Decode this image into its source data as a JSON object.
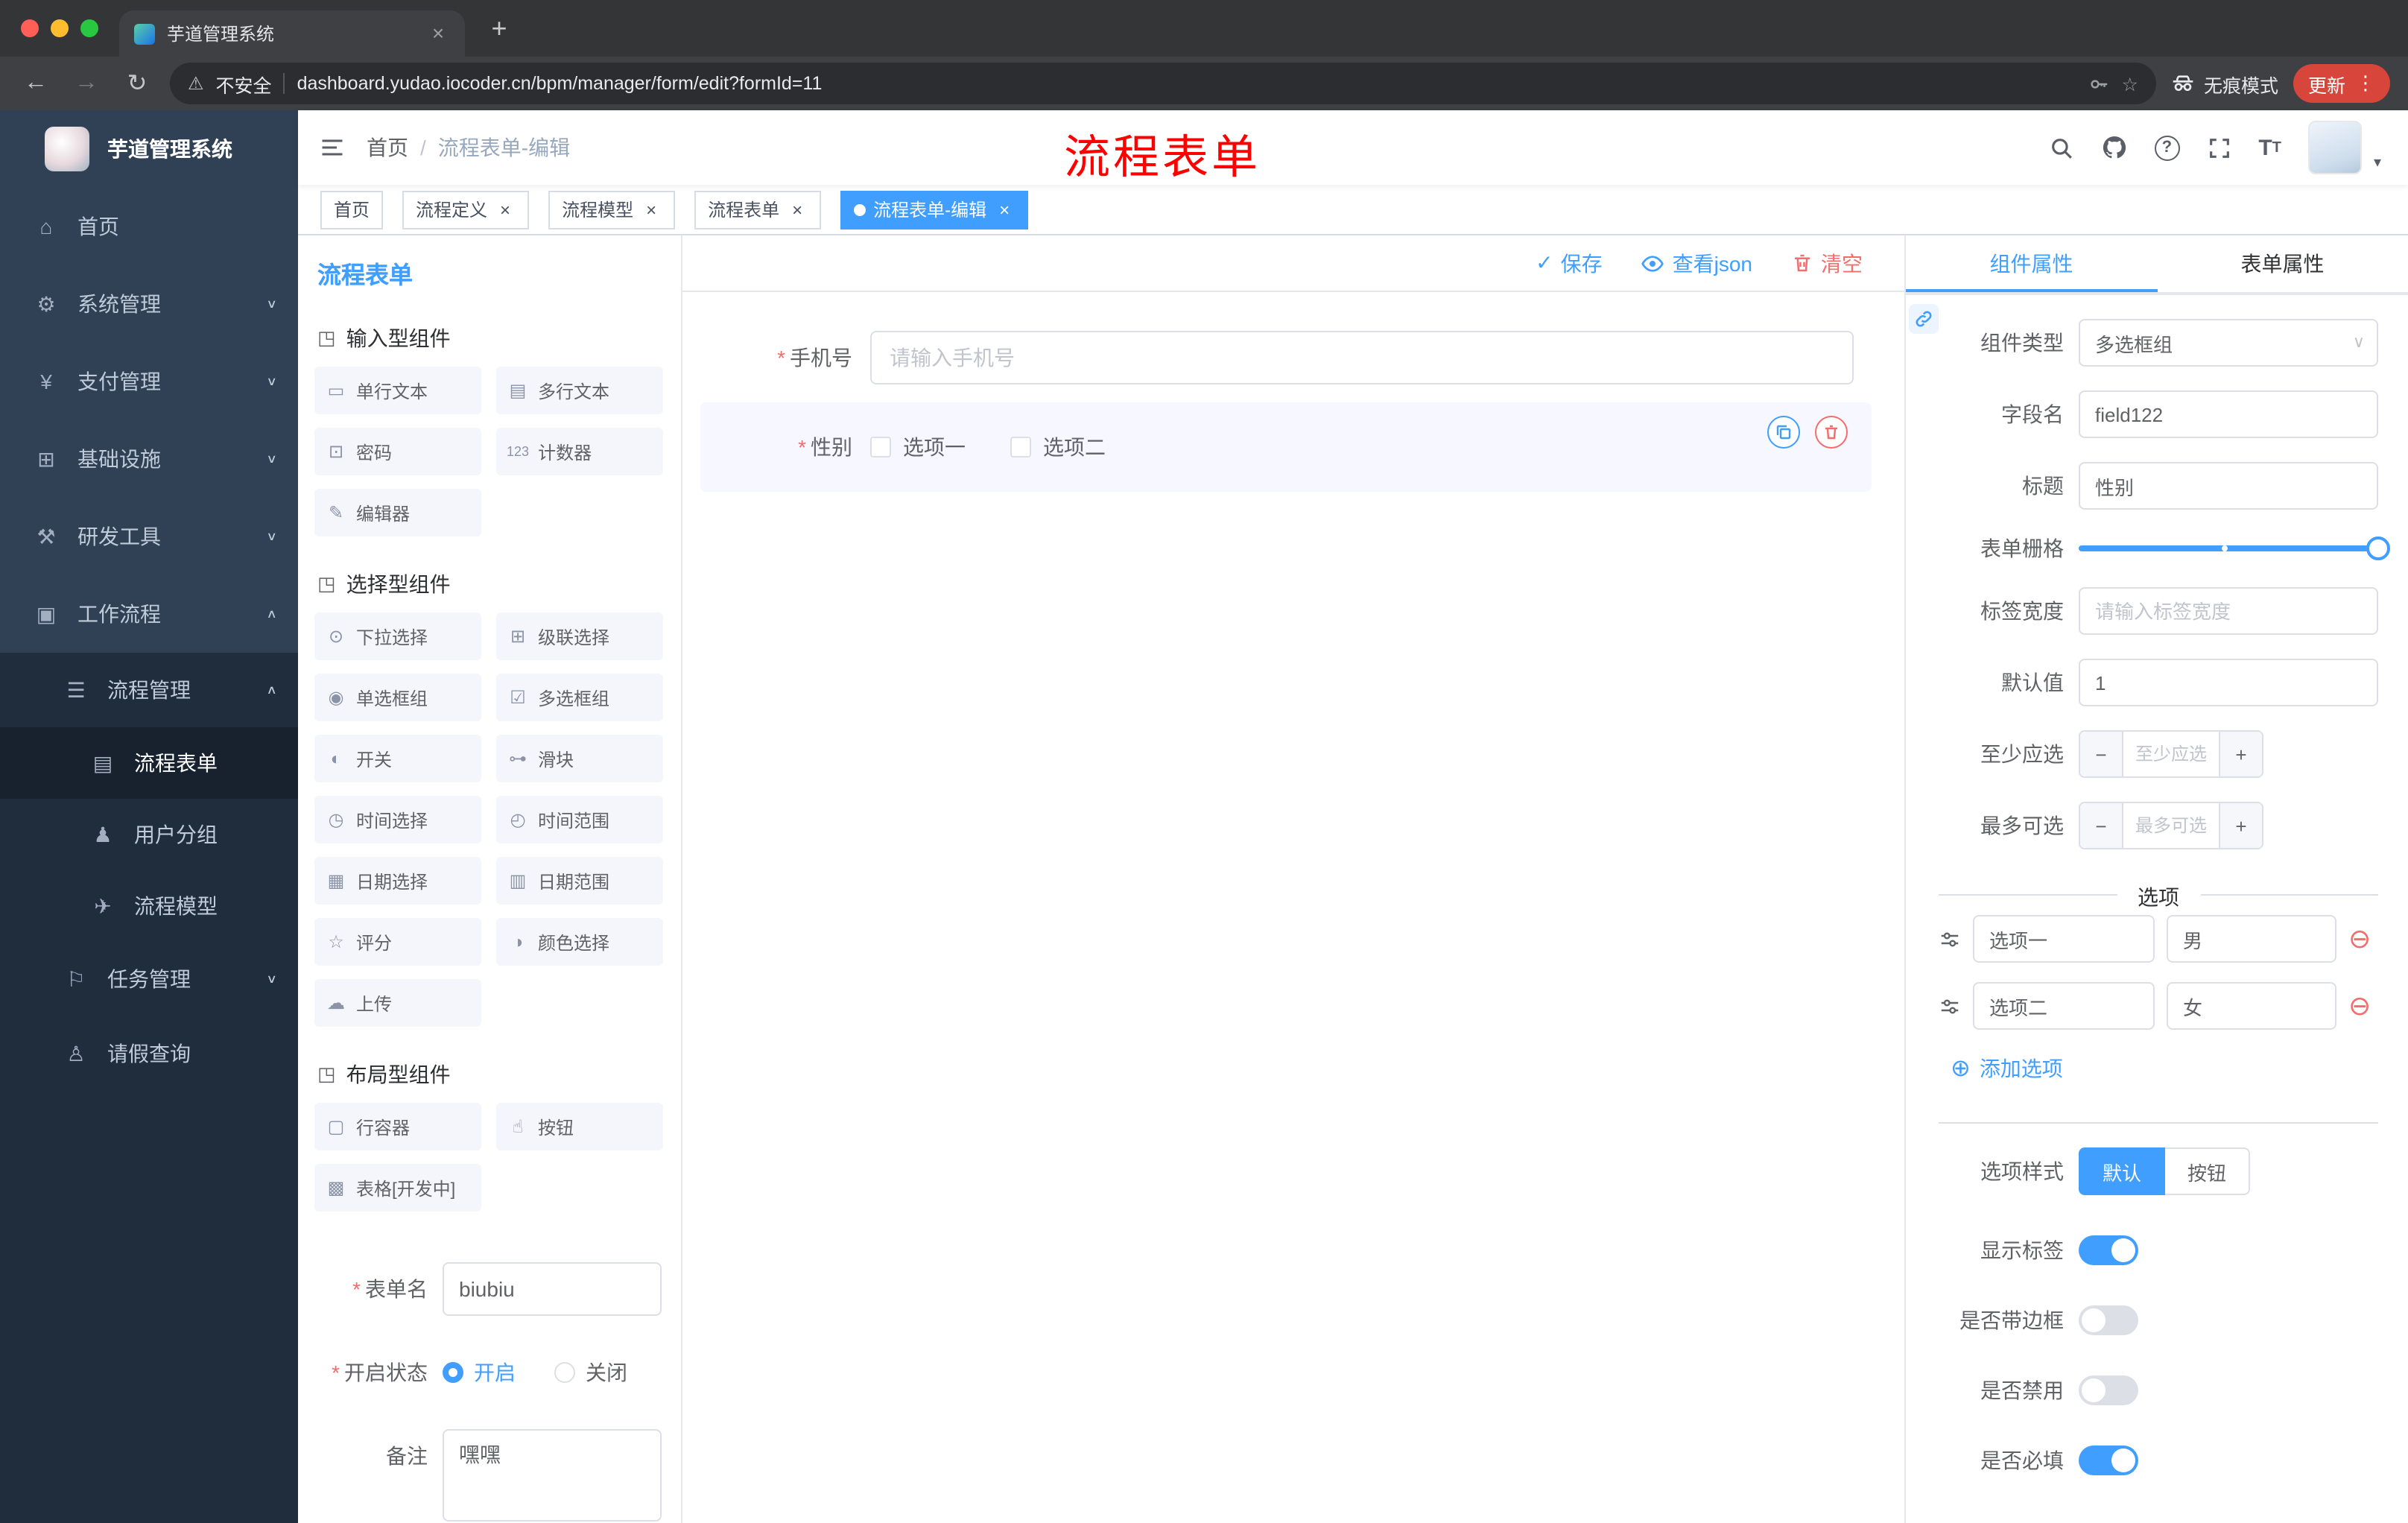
{
  "colors": {
    "accent": "#409eff",
    "danger": "#f56c6c",
    "sidebar_bg": "#304156",
    "sidebar_submenu_bg": "#1f2d3d",
    "update_button": "#d8453a",
    "annotation": "#ff0000",
    "selected_widget_bg": "#f6f7ff"
  },
  "icons": {
    "close": "×",
    "new_tab": "+",
    "back": "←",
    "forward": "→",
    "reload": "↻",
    "warning": "⚠",
    "star": "☆",
    "more": "⋮",
    "caret_down": "▾",
    "question": "?",
    "check": "✓",
    "chevron_down": "∨",
    "chevron_up": "∧",
    "add_circle": "⊕",
    "remove_circle": "⊖"
  },
  "browser": {
    "tab_title": "芋道管理系统",
    "security_label": "不安全",
    "url": "dashboard.yudao.iocoder.cn/bpm/manager/form/edit?formId=11",
    "incognito_label": "无痕模式",
    "update_label": "更新"
  },
  "annotation": {
    "text": "流程表单"
  },
  "sidebar": {
    "logo_title": "芋道管理系统",
    "items": [
      {
        "label": "首页",
        "glyph": "⌂"
      },
      {
        "label": "系统管理",
        "glyph": "⚙",
        "chevron": "∨"
      },
      {
        "label": "支付管理",
        "glyph": "¥",
        "chevron": "∨"
      },
      {
        "label": "基础设施",
        "glyph": "⊞",
        "chevron": "∨"
      },
      {
        "label": "研发工具",
        "glyph": "⚒",
        "chevron": "∨"
      },
      {
        "label": "工作流程",
        "glyph": "▣",
        "chevron": "∧"
      },
      {
        "label": "流程管理",
        "glyph": "☰",
        "chevron": "∧"
      },
      {
        "label": "流程表单",
        "glyph": "▤"
      },
      {
        "label": "用户分组",
        "glyph": "♟"
      },
      {
        "label": "流程模型",
        "glyph": "✈"
      },
      {
        "label": "任务管理",
        "glyph": "⚐",
        "chevron": "∨"
      },
      {
        "label": "请假查询",
        "glyph": "♙"
      }
    ]
  },
  "header": {
    "breadcrumb_home": "首页",
    "breadcrumb_sep": "/",
    "breadcrumb_current": "流程表单-编辑"
  },
  "tags": [
    {
      "label": "首页"
    },
    {
      "label": "流程定义"
    },
    {
      "label": "流程模型"
    },
    {
      "label": "流程表单"
    },
    {
      "label": "流程表单-编辑"
    }
  ],
  "designer": {
    "panel_title": "流程表单",
    "actions": {
      "save": "保存",
      "view_json": "查看json",
      "clear": "清空"
    },
    "palette": {
      "sections": [
        {
          "title": "输入型组件",
          "icon_glyph": "◳",
          "items": [
            {
              "label": "单行文本",
              "glyph": "▭"
            },
            {
              "label": "多行文本",
              "glyph": "▤"
            },
            {
              "label": "密码",
              "glyph": "⊡"
            },
            {
              "label": "计数器",
              "glyph": "123"
            },
            {
              "label": "编辑器",
              "glyph": "✎"
            }
          ]
        },
        {
          "title": "选择型组件",
          "icon_glyph": "◳",
          "items": [
            {
              "label": "下拉选择",
              "glyph": "⊙"
            },
            {
              "label": "级联选择",
              "glyph": "⊞"
            },
            {
              "label": "单选框组",
              "glyph": "◉"
            },
            {
              "label": "多选框组",
              "glyph": "☑"
            },
            {
              "label": "开关",
              "glyph": "◐"
            },
            {
              "label": "滑块",
              "glyph": "⊶"
            },
            {
              "label": "时间选择",
              "glyph": "◷"
            },
            {
              "label": "时间范围",
              "glyph": "◴"
            },
            {
              "label": "日期选择",
              "glyph": "▦"
            },
            {
              "label": "日期范围",
              "glyph": "▥"
            },
            {
              "label": "评分",
              "glyph": "☆"
            },
            {
              "label": "颜色选择",
              "glyph": "◑"
            },
            {
              "label": "上传",
              "glyph": "☁"
            }
          ]
        },
        {
          "title": "布局型组件",
          "icon_glyph": "◳",
          "items": [
            {
              "label": "行容器",
              "glyph": "▢"
            },
            {
              "label": "按钮",
              "glyph": "☝"
            },
            {
              "label": "表格[开发中]",
              "glyph": "▩"
            }
          ]
        }
      ]
    },
    "meta": {
      "name_label": "表单名",
      "name_value": "biubiu",
      "status_label": "开启状态",
      "status_on": "开启",
      "status_off": "关闭",
      "remark_label": "备注",
      "remark_value": "嘿嘿"
    },
    "canvas": {
      "phone_label": "手机号",
      "phone_placeholder": "请输入手机号",
      "gender_label": "性别",
      "gender_option1": "选项一",
      "gender_option2": "选项二"
    },
    "props": {
      "tab_component": "组件属性",
      "tab_form": "表单属性",
      "component_type_label": "组件类型",
      "component_type_value": "多选框组",
      "field_name_label": "字段名",
      "field_name_value": "field122",
      "title_label": "标题",
      "title_value": "性别",
      "grid_label": "表单栅格",
      "label_width_label": "标签宽度",
      "label_width_placeholder": "请输入标签宽度",
      "default_label": "默认值",
      "default_value": "1",
      "min_label": "至少应选",
      "min_placeholder": "至少应选",
      "max_label": "最多可选",
      "max_placeholder": "最多可选",
      "options_title": "选项",
      "options": [
        {
          "label": "选项一",
          "value": "男"
        },
        {
          "label": "选项二",
          "value": "女"
        }
      ],
      "add_option": "添加选项",
      "style_label": "选项样式",
      "style_default": "默认",
      "style_button": "按钮",
      "switches": [
        {
          "label": "显示标签",
          "on": true
        },
        {
          "label": "是否带边框",
          "on": false
        },
        {
          "label": "是否禁用",
          "on": false
        },
        {
          "label": "是否必填",
          "on": true
        }
      ]
    }
  }
}
